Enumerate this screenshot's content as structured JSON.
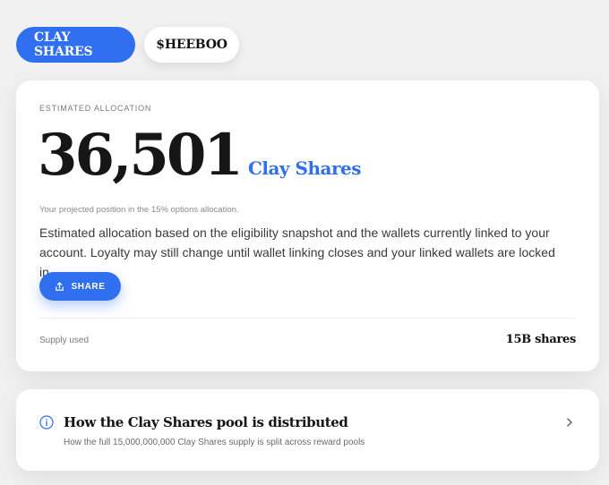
{
  "tabs": [
    {
      "label": "CLAY SHARES",
      "active": true
    },
    {
      "label": "$HEEBOO",
      "active": false
    }
  ],
  "allocation": {
    "eyebrow": "ESTIMATED ALLOCATION",
    "amount": "36,501",
    "unit": "Clay Shares",
    "subnote": "Your projected position in the 15% options allocation.",
    "description": "Estimated allocation based on the eligibility snapshot and the wallets currently linked to your account. Loyalty may still change until wallet linking closes and your linked wallets are locked in.",
    "share_label": "SHARE",
    "supply_label": "Supply used",
    "supply_value": "15B shares"
  },
  "pool": {
    "title": "How the Clay Shares pool is distributed",
    "subtitle": "How the full 15,000,000,000 Clay Shares supply is split across reward pools"
  },
  "colors": {
    "accent": "#2f6ff0",
    "background": "#f1f1f1",
    "card": "#ffffff"
  },
  "icons": {
    "share": "share-icon",
    "info": "info-icon",
    "chevron": "chevron-right-icon"
  }
}
